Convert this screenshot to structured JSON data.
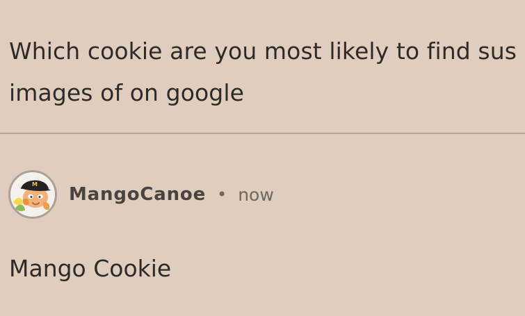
{
  "post": {
    "question": "Which cookie are you most likely to find sus images of on google"
  },
  "reply": {
    "author": "MangoCanoe",
    "separator": "•",
    "timestamp": "now",
    "body": "Mango Cookie",
    "avatar_icon": "mango-cookie-avatar-icon"
  },
  "colors": {
    "background": "#dfcdbd",
    "text": "#2f2a27",
    "divider": "#b3a59b",
    "muted_text": "#6d6661"
  }
}
